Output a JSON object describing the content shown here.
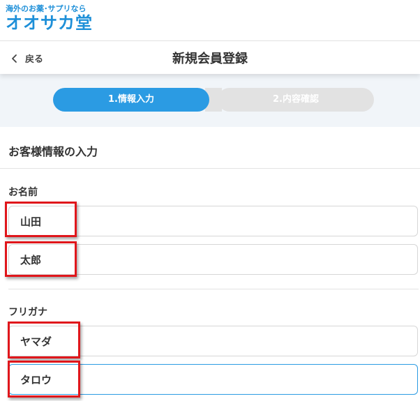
{
  "logo": {
    "tagline": "海外のお薬･サプリなら",
    "name": "オオサカ堂"
  },
  "header": {
    "back_label": "戻る",
    "title": "新規会員登録"
  },
  "steps": [
    {
      "label": "1.情報入力",
      "active": true
    },
    {
      "label": "2.内容確認",
      "active": false
    }
  ],
  "section": {
    "title": "お客様情報の入力"
  },
  "name_group": {
    "label": "お名前",
    "last_name": "山田",
    "first_name": "太郎"
  },
  "kana_group": {
    "label": "フリガナ",
    "last_name": "ヤマダ",
    "first_name": "タロウ"
  },
  "colors": {
    "brand": "#1d8fd8",
    "active_step": "#2b9be3",
    "inactive_step": "#e2e2e2",
    "highlight": "#e0161b",
    "focus_border": "#2b9be3"
  },
  "icons": {
    "back": "chevron-left-icon"
  }
}
